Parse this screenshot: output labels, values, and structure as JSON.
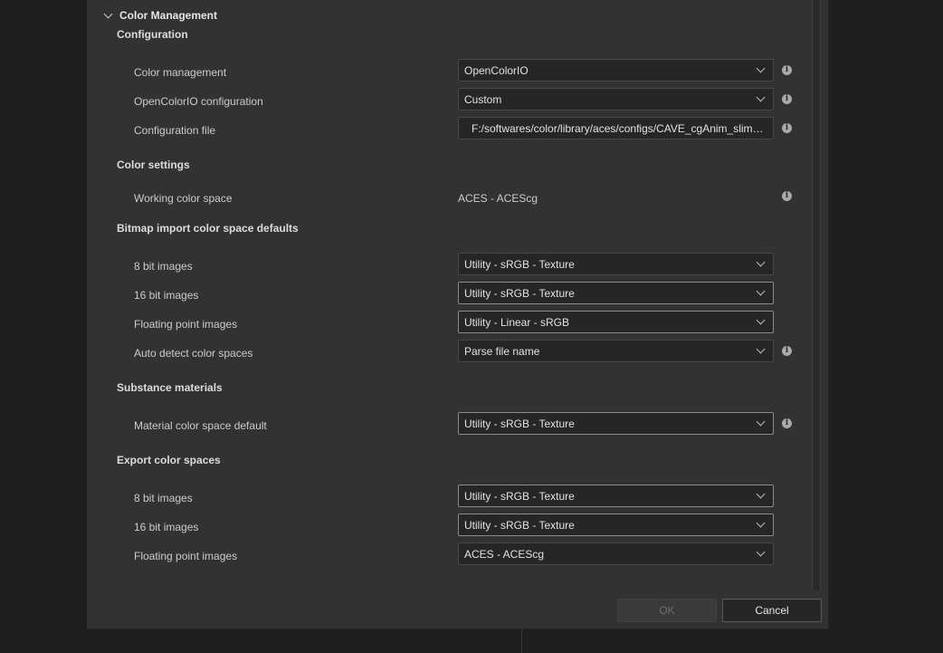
{
  "section": {
    "title": "Color Management"
  },
  "configuration": {
    "heading": "Configuration",
    "color_management": {
      "label": "Color management",
      "value": "OpenColorIO"
    },
    "ocio_config": {
      "label": "OpenColorIO configuration",
      "value": "Custom"
    },
    "config_file": {
      "label": "Configuration file",
      "value": "F:/softwares/color/library/aces/configs/CAVE_cgAnim_slim_aces..."
    }
  },
  "color_settings": {
    "heading": "Color settings",
    "working_space": {
      "label": "Working color space",
      "value": "ACES - ACEScg"
    }
  },
  "bitmap_import": {
    "heading": "Bitmap import color space defaults",
    "bit8": {
      "label": "8 bit images",
      "value": "Utility - sRGB - Texture"
    },
    "bit16": {
      "label": "16 bit images",
      "value": "Utility - sRGB - Texture"
    },
    "float": {
      "label": "Floating point images",
      "value": "Utility - Linear - sRGB"
    },
    "auto_detect": {
      "label": "Auto detect color spaces",
      "value": "Parse file name"
    }
  },
  "substance": {
    "heading": "Substance materials",
    "material_default": {
      "label": "Material color space default",
      "value": "Utility - sRGB - Texture"
    }
  },
  "export": {
    "heading": "Export color spaces",
    "bit8": {
      "label": "8 bit images",
      "value": "Utility - sRGB - Texture"
    },
    "bit16": {
      "label": "16 bit images",
      "value": "Utility - sRGB - Texture"
    },
    "float": {
      "label": "Floating point images",
      "value": "ACES - ACEScg"
    }
  },
  "buttons": {
    "ok": "OK",
    "cancel": "Cancel"
  },
  "icons": {
    "info": "info-icon",
    "dropdown": "chevron-down-icon",
    "collapse": "chevron-down-icon"
  },
  "colors": {
    "dialog_bg": "#323232",
    "field_bg": "#262626",
    "app_bg": "#1f1f1f"
  }
}
